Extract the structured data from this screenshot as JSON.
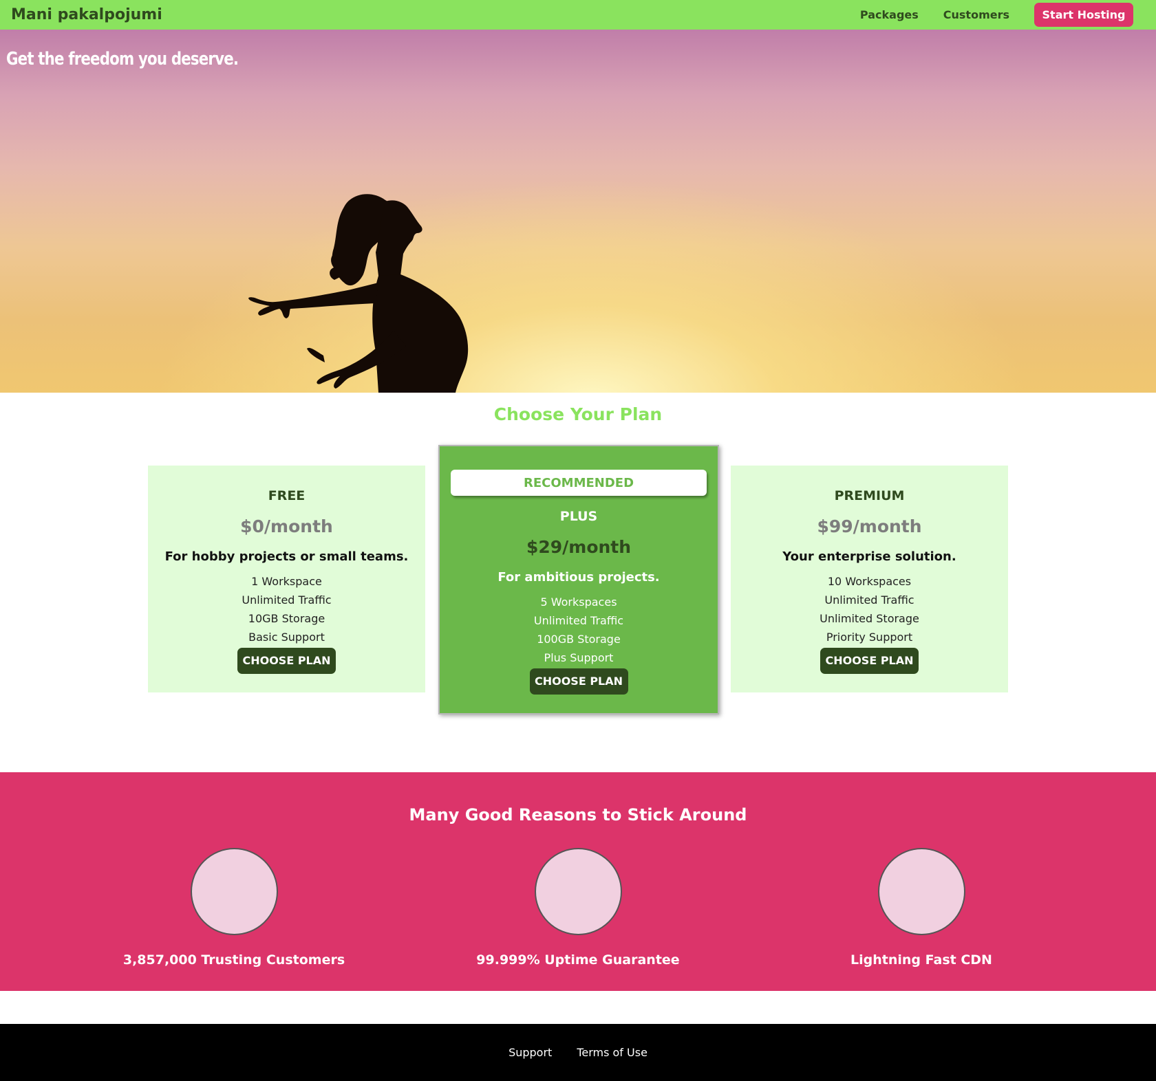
{
  "header": {
    "brand": "Mani pakalpojumi",
    "nav": {
      "packages": "Packages",
      "customers": "Customers",
      "cta": "Start Hosting"
    }
  },
  "hero": {
    "title": "Get the freedom you deserve."
  },
  "plans": {
    "title": "Choose Your Plan",
    "items": [
      {
        "name": "FREE",
        "price": "$0/month",
        "description": "For hobby projects or small teams.",
        "features": [
          "1 Workspace",
          "Unlimited Traffic",
          "10GB Storage",
          "Basic Support"
        ],
        "button": "CHOOSE PLAN"
      },
      {
        "badge": "RECOMMENDED",
        "name": "PLUS",
        "price": "$29/month",
        "description": "For ambitious projects.",
        "features": [
          "5 Workspaces",
          "Unlimited Traffic",
          "100GB Storage",
          "Plus Support"
        ],
        "button": "CHOOSE PLAN"
      },
      {
        "name": "PREMIUM",
        "price": "$99/month",
        "description": "Your enterprise solution.",
        "features": [
          "10 Workspaces",
          "Unlimited Traffic",
          "Unlimited Storage",
          "Priority Support"
        ],
        "button": "CHOOSE PLAN"
      }
    ]
  },
  "reasons": {
    "title": "Many Good Reasons to Stick Around",
    "items": [
      {
        "label": "3,857,000 Trusting Customers"
      },
      {
        "label": "99.999% Uptime Guarantee"
      },
      {
        "label": "Lightning Fast CDN"
      }
    ]
  },
  "footer": {
    "links": [
      "Support",
      "Terms of Use"
    ]
  },
  "colors": {
    "header_bg": "#8ae35e",
    "accent_pink": "#dc346a",
    "dark_green": "#2f4a1e",
    "plan_bg": "#e1fcd8",
    "plan_highlight": "#6bb84a",
    "footer_bg": "#000000"
  }
}
